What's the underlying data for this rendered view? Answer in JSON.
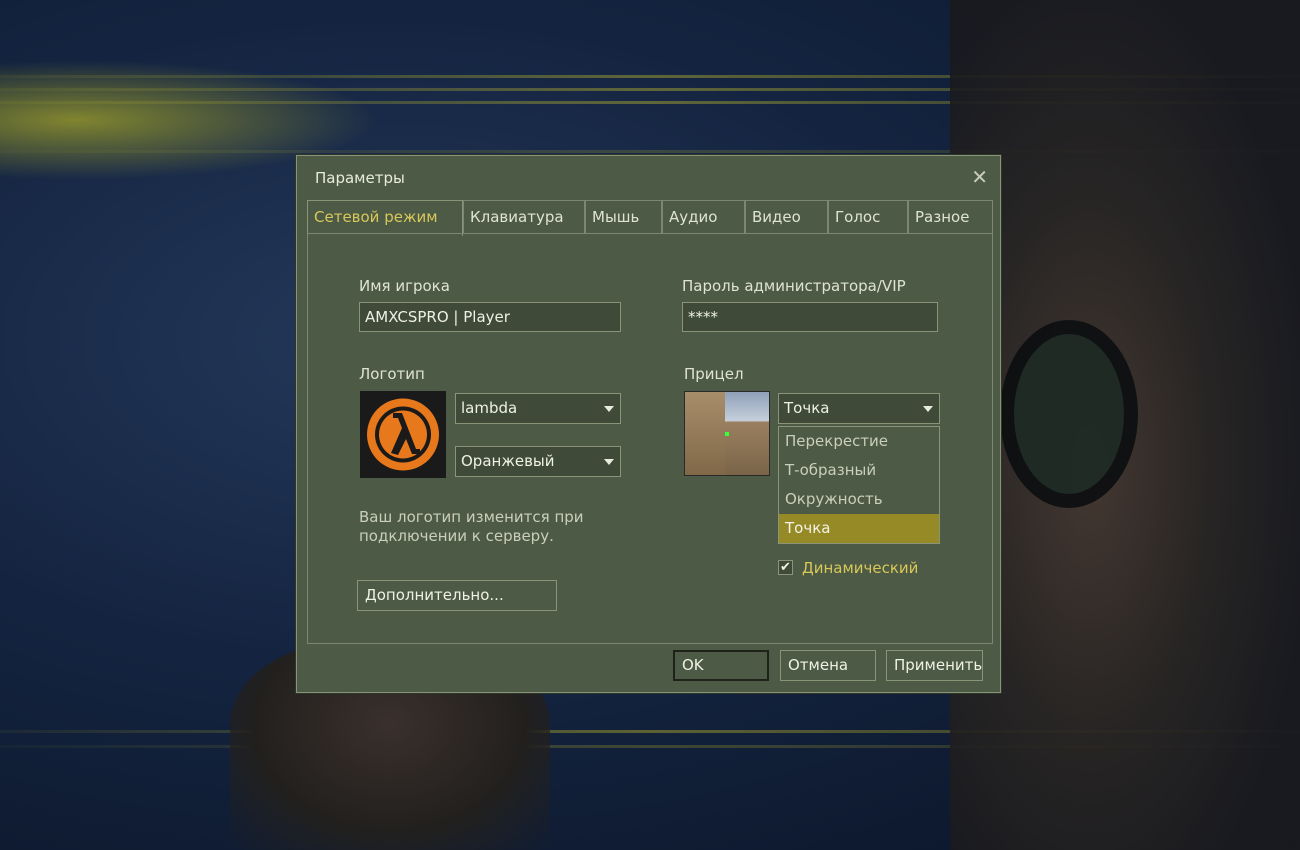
{
  "dialog": {
    "title": "Параметры",
    "tabs": [
      {
        "label": "Сетевой режим"
      },
      {
        "label": "Клавиатура"
      },
      {
        "label": "Мышь"
      },
      {
        "label": "Аудио"
      },
      {
        "label": "Видео"
      },
      {
        "label": "Голос"
      },
      {
        "label": "Разное"
      }
    ],
    "active_tab": "Сетевой режим"
  },
  "multiplayer": {
    "player_name_label": "Имя игрока",
    "player_name_value": "AMXCSPRO | Player",
    "admin_password_label": "Пароль администратора/VIP",
    "admin_password_value": "****",
    "logo_label": "Логотип",
    "logo_select": "lambda",
    "logo_color_select": "Оранжевый",
    "logo_hint": "Ваш логотип изменится при подключении к серверу.",
    "advanced_button": "Дополнительно...",
    "crosshair_label": "Прицел",
    "crosshair_select": "Точка",
    "crosshair_options": [
      {
        "label": "Перекрестие"
      },
      {
        "label": "Т-образный"
      },
      {
        "label": "Окружность"
      },
      {
        "label": "Точка"
      }
    ],
    "dynamic_label": "Динамический",
    "dynamic_checked": true
  },
  "footer": {
    "ok": "OK",
    "cancel": "Отмена",
    "apply": "Применить"
  },
  "colors": {
    "accent": "#d8c85a",
    "dialog_bg": "#4d5a45",
    "selection": "#958a26"
  }
}
